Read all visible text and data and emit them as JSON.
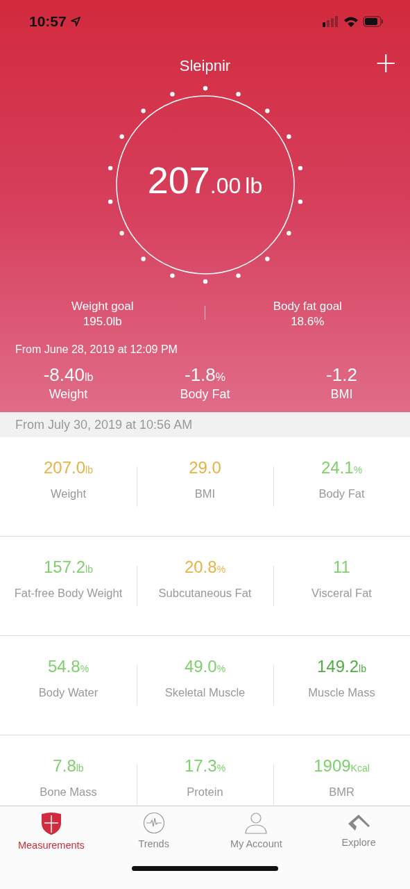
{
  "status_bar": {
    "time": "10:57"
  },
  "header": {
    "title": "Sleipnir",
    "add": "+"
  },
  "current": {
    "value": "207",
    "decimals": ".00",
    "unit": "lb"
  },
  "goals": [
    {
      "label": "Weight goal",
      "value": "195.0lb"
    },
    {
      "label": "Body fat goal",
      "value": "18.6%"
    }
  ],
  "change": {
    "since": "From June 28, 2019 at 12:09 PM",
    "items": [
      {
        "value": "-8.40",
        "unit": "lb",
        "label": "Weight"
      },
      {
        "value": "-1.8",
        "unit": "%",
        "label": "Body Fat"
      },
      {
        "value": "-1.2",
        "label": "BMI"
      }
    ]
  },
  "measured": "From July 30, 2019 at 10:56 AM",
  "metrics": [
    {
      "value": "207.0",
      "unit": "lb",
      "label": "Weight",
      "color": "#e8b245"
    },
    {
      "value": "29.0",
      "label": "BMI",
      "color": "#e8b245"
    },
    {
      "value": "24.1",
      "unit": "%",
      "label": "Body Fat",
      "color": "#7ed06c"
    },
    {
      "value": "157.2",
      "unit": "lb",
      "label": "Fat-free Body Weight",
      "color": "#7ed06c"
    },
    {
      "value": "20.8",
      "unit": "%",
      "label": "Subcutaneous Fat",
      "color": "#e8b245"
    },
    {
      "value": "11",
      "label": "Visceral Fat",
      "color": "#7ed06c"
    },
    {
      "value": "54.8",
      "unit": "%",
      "label": "Body Water",
      "color": "#7ed06c"
    },
    {
      "value": "49.0",
      "unit": "%",
      "label": "Skeletal Muscle",
      "color": "#7ed06c"
    },
    {
      "value": "149.2",
      "unit": "lb",
      "label": "Muscle Mass",
      "color": "#4fae45"
    },
    {
      "value": "7.8",
      "unit": "lb",
      "label": "Bone Mass",
      "color": "#7ed06c"
    },
    {
      "value": "17.3",
      "unit": "%",
      "label": "Protein",
      "color": "#7ed06c"
    },
    {
      "value": "1909",
      "unit": "Kcal",
      "label": "BMR",
      "color": "#7ed06c"
    }
  ],
  "tabs": [
    {
      "label": "Measurements",
      "kind": "shield",
      "selected": true
    },
    {
      "label": "Trends",
      "kind": "pulse",
      "selected": false
    },
    {
      "label": "My Account",
      "kind": "person",
      "selected": false
    },
    {
      "label": "Explore",
      "kind": "mountain",
      "selected": false
    }
  ]
}
